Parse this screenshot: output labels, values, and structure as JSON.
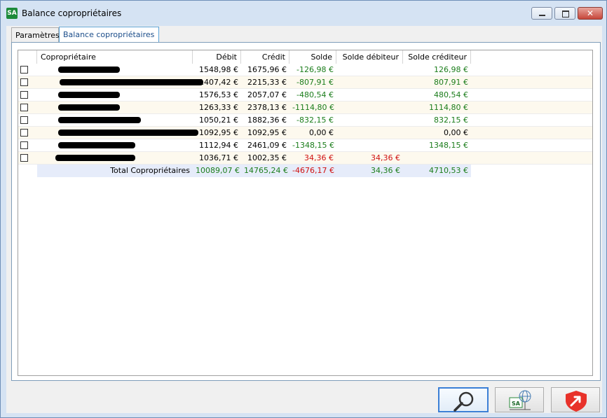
{
  "window": {
    "title": "Balance copropriétaires",
    "icon_text": "SA",
    "close_label": "✕"
  },
  "tabs": [
    {
      "label": "Paramètres"
    },
    {
      "label": "Balance copropriétaires"
    }
  ],
  "grid": {
    "headers": [
      "Copropriétaire",
      "Débit",
      "Crédit",
      "Solde",
      "Solde débiteur",
      "Solde créditeur"
    ],
    "rows": [
      {
        "debit": "1548,98 €",
        "credit": "1675,96 €",
        "solde": "-126,98 €",
        "solde_debiteur": "",
        "solde_crediteur": "126,98 €"
      },
      {
        "debit": "1407,42 €",
        "credit": "2215,33 €",
        "solde": "-807,91 €",
        "solde_debiteur": "",
        "solde_crediteur": "807,91 €"
      },
      {
        "debit": "1576,53 €",
        "credit": "2057,07 €",
        "solde": "-480,54 €",
        "solde_debiteur": "",
        "solde_crediteur": "480,54 €"
      },
      {
        "debit": "1263,33 €",
        "credit": "2378,13 €",
        "solde": "-1114,80 €",
        "solde_debiteur": "",
        "solde_crediteur": "1114,80 €"
      },
      {
        "debit": "1050,21 €",
        "credit": "1882,36 €",
        "solde": "-832,15 €",
        "solde_debiteur": "",
        "solde_crediteur": "832,15 €"
      },
      {
        "debit": "1092,95 €",
        "credit": "1092,95 €",
        "solde": "0,00 €",
        "solde_debiteur": "",
        "solde_crediteur": "0,00 €"
      },
      {
        "debit": "1112,94 €",
        "credit": "2461,09 €",
        "solde": "-1348,15 €",
        "solde_debiteur": "",
        "solde_crediteur": "1348,15 €"
      },
      {
        "debit": "1036,71 €",
        "credit": "1002,35 €",
        "solde": "34,36 €",
        "solde_debiteur": "34,36 €",
        "solde_crediteur": ""
      }
    ],
    "total": {
      "label": "Total Copropriétaires",
      "debit": "10089,07 €",
      "credit": "14765,24 €",
      "solde": "-4676,17 €",
      "solde_debiteur": "34,36 €",
      "solde_crediteur": "4710,53 €"
    }
  },
  "buttons": {
    "search_icon": "search-icon",
    "export_icon": "network-export-icon",
    "export_icon_text": "SA",
    "exit_icon": "exit-shield-icon"
  },
  "colors": {
    "positive": "#1b7d1b",
    "negative": "#d01010",
    "row_alt": "#fdf9ee",
    "total_bg": "#e6ecfa"
  }
}
